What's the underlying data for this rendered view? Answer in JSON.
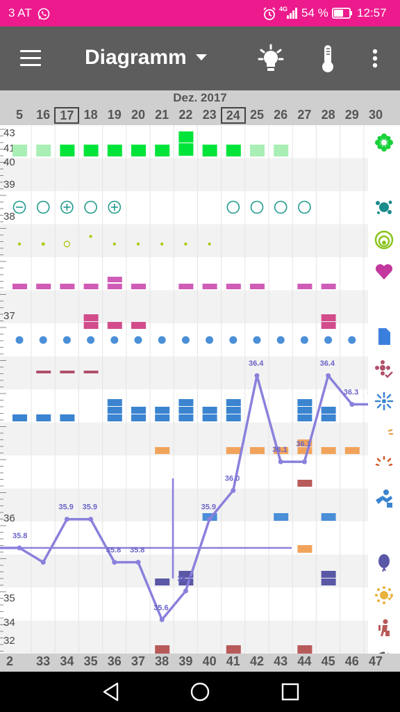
{
  "status": {
    "carrier": "3 AT",
    "network": "4G",
    "battery": "54 %",
    "time": "12:57"
  },
  "appbar": {
    "title": "Diagramm"
  },
  "icons": {
    "menu": "hamburger-menu-icon",
    "dropdown": "caret-down-icon",
    "idea": "lightbulb-icon",
    "temperature": "thermometer-icon",
    "overflow": "more-vert-icon"
  },
  "header": {
    "month": "Dez. 2017",
    "days": [
      "5",
      "16",
      "17",
      "18",
      "19",
      "20",
      "21",
      "22",
      "23",
      "24",
      "25",
      "26",
      "27",
      "28",
      "29",
      "30"
    ],
    "boxed_days": [
      "17",
      "24"
    ]
  },
  "cycle_days": [
    "2",
    "33",
    "34",
    "35",
    "36",
    "37",
    "38",
    "39",
    "40",
    "41",
    "42",
    "43",
    "44",
    "45",
    "46",
    "47"
  ],
  "y_labels": {
    "43": "43",
    "41": "41",
    "40": "40",
    "39": "39",
    "38": "38",
    "37": "37",
    "36": "36",
    "35": "35",
    "34": "34",
    "32": "32"
  },
  "temps": [
    {
      "col": 0,
      "v": 35.8,
      "label": "35.8"
    },
    {
      "col": 1,
      "v": 35.75,
      "label": ""
    },
    {
      "col": 2,
      "v": 35.9,
      "label": "35.9"
    },
    {
      "col": 3,
      "v": 35.9,
      "label": "35.9"
    },
    {
      "col": 4,
      "v": 35.75,
      "label": "35.8"
    },
    {
      "col": 5,
      "v": 35.75,
      "label": "35.8"
    },
    {
      "col": 6,
      "v": 35.55,
      "label": "35.6"
    },
    {
      "col": 7,
      "v": 35.65,
      "label": "35.7"
    },
    {
      "col": 8,
      "v": 35.9,
      "label": "35.9"
    },
    {
      "col": 9,
      "v": 36.0,
      "label": "36.0"
    },
    {
      "col": 10,
      "v": 36.4,
      "label": "36.4"
    },
    {
      "col": 11,
      "v": 36.1,
      "label": ""
    },
    {
      "col": 12,
      "v": 36.1,
      "label": "36.1"
    },
    {
      "col": 13,
      "v": 36.4,
      "label": "36.4"
    },
    {
      "col": 14,
      "v": 36.3,
      "label": "36.3"
    },
    {
      "col": 15,
      "v": 36.3,
      "label": "36.3"
    }
  ],
  "extra_labels": [
    "36.1"
  ],
  "coverline": 35.8,
  "colors": {
    "bleeding": "#00e43a",
    "bleeding_light": "#a8eeb5",
    "cervix": "#1f9a8c",
    "mucus": "#b3c81a",
    "sex": "#cf5cb6",
    "breast": "#d24c8c",
    "pill": "#4a8fd8",
    "mood": "#b0506a",
    "pain": "#3b84d0",
    "libido": "#f1a35b",
    "custom": "#5a57a6",
    "ovulation": "#b85a5a",
    "temp_line": "#8a80dc",
    "temp_label": "#6a64c8"
  },
  "side_icons": [
    "flower-icon",
    "drop-icon",
    "splash-icon",
    "cervix-icon",
    "heart-icon",
    "breast-icon",
    "document-icon",
    "flower-check-icon",
    "sparkle-icon",
    "face-pain-icon",
    "acne-icon",
    "workout-icon",
    "head-pain-icon",
    "balloon-icon",
    "energy-icon",
    "person-icon",
    "refresh-icon"
  ]
}
